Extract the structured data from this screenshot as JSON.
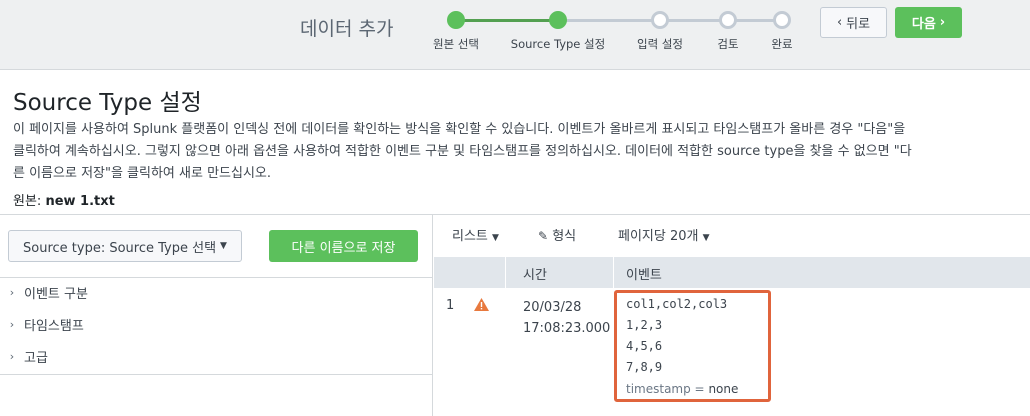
{
  "wizard": {
    "title": "데이터 추가",
    "steps": [
      {
        "label": "원본 선택",
        "state": "done"
      },
      {
        "label": "Source Type 설정",
        "state": "current"
      },
      {
        "label": "입력 설정",
        "state": "todo"
      },
      {
        "label": "검토",
        "state": "todo"
      },
      {
        "label": "완료",
        "state": "todo"
      }
    ],
    "back_label": "뒤로",
    "next_label": "다음",
    "colors": {
      "accent": "#5cc05c",
      "inactive": "#c3cbd4",
      "highlight": "#e0643c"
    }
  },
  "page": {
    "title": "Source Type 설정",
    "description": "이 페이지를 사용하여 Splunk 플랫폼이 인덱싱 전에 데이터를 확인하는 방식을 확인할 수 있습니다. 이벤트가 올바르게 표시되고 타임스탬프가 올바른 경우 \"다음\"을 클릭하여 계속하십시오. 그렇지 않으면 아래 옵션을 사용하여 적합한 이벤트 구분 및 타임스탬프를 정의하십시오. 데이터에 적합한 source type을 찾을 수 없으면 \"다른 이름으로 저장\"을 클릭하여 새로 만드십시오.",
    "source_label": "원본:",
    "source_value": "new 1.txt"
  },
  "left_panel": {
    "sourcetype_select": "Source type: Source Type 선택",
    "save_as_label": "다른 이름으로 저장",
    "sections": [
      "이벤트 구분",
      "타임스탬프",
      "고급"
    ]
  },
  "toolbar": {
    "list_label": "리스트",
    "format_label": "형식",
    "per_page_label": "페이지당 20개"
  },
  "table": {
    "headers": {
      "time": "시간",
      "event": "이벤트"
    },
    "rows": [
      {
        "index": "1",
        "status_icon": "warning-icon",
        "date": "20/03/28",
        "time": "17:08:23.000",
        "event_lines": [
          "col1,col2,col3",
          "1,2,3",
          "4,5,6",
          "7,8,9"
        ],
        "field_key": "timestamp =",
        "field_value": "none"
      }
    ]
  }
}
